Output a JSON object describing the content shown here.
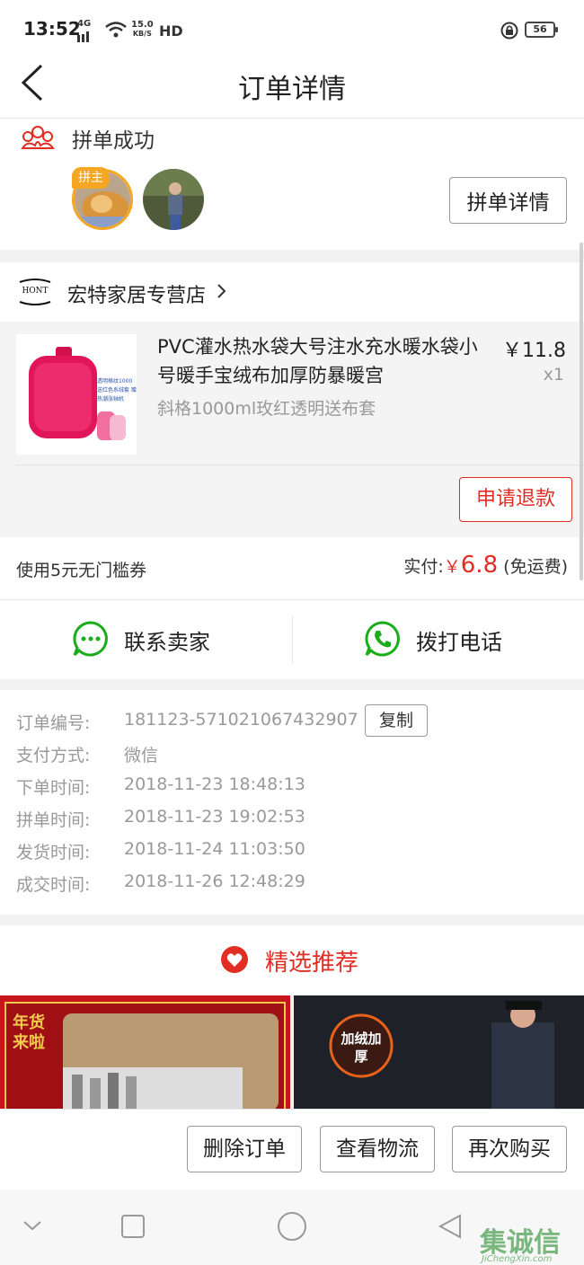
{
  "status_bar": {
    "time": "13:52",
    "network": "4G",
    "speed": "15.0",
    "speed_unit": "KB/S",
    "hd": "HD",
    "battery": "56"
  },
  "nav": {
    "title": "订单详情"
  },
  "group": {
    "status": "拼单成功",
    "host_badge": "拼主",
    "detail_button": "拼单详情"
  },
  "shop": {
    "logo_text": "HONT",
    "name": "宏特家居专营店"
  },
  "product": {
    "title": "PVC灌水热水袋大号注水充水暖水袋小号暖手宝绒布加厚防暴暖宫",
    "spec": "斜格1000ml玫红透明送布套",
    "price": "￥11.8",
    "quantity": "x1",
    "image_caption": "透明格纹1000 送红色系绒套 赠热潮涨轴机",
    "refund_button": "申请退款"
  },
  "payment": {
    "coupon": "使用5元无门槛券",
    "paid_label": "实付:",
    "currency": "￥",
    "amount": "6.8",
    "shipping": "(免运费)"
  },
  "contact": {
    "seller_label": "联系卖家",
    "phone_label": "拨打电话"
  },
  "order_info": {
    "copy_button": "复制",
    "rows": [
      {
        "label": "订单编号:",
        "value": "181123-571021067432907"
      },
      {
        "label": "支付方式:",
        "value": "微信"
      },
      {
        "label": "下单时间:",
        "value": "2018-11-23 18:48:13"
      },
      {
        "label": "拼单时间:",
        "value": "2018-11-23 19:02:53"
      },
      {
        "label": "发货时间:",
        "value": "2018-11-24 11:03:50"
      },
      {
        "label": "成交时间:",
        "value": "2018-11-26 12:48:29"
      }
    ]
  },
  "recommend": {
    "title": "精选推荐",
    "banner1_text": "年货来啦",
    "banner2_text": "加绒加厚"
  },
  "actions": {
    "delete": "删除订单",
    "logistics": "查看物流",
    "rebuy": "再次购买"
  },
  "watermark": {
    "text": "集诚信",
    "url": "JiChengXin.com"
  },
  "colors": {
    "brand": "#e02e24",
    "green": "#1aad19",
    "badge": "#f5a623"
  }
}
